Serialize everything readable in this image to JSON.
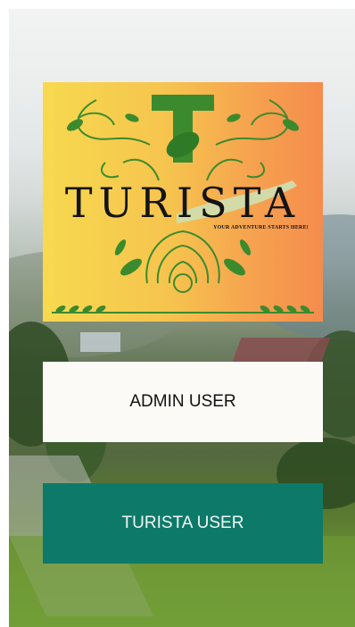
{
  "logo": {
    "letter": "T",
    "brand": "TURISTA",
    "tagline": "YOUR ADVENTURE STARTS HERE!"
  },
  "buttons": {
    "admin_label": "ADMIN USER",
    "turista_label": "TURISTA USER"
  },
  "colors": {
    "turista_button": "#0d7a69",
    "admin_button": "#fbfaf7",
    "logo_green": "#3b8b2e",
    "logo_gradient_start": "#f7d94f",
    "logo_gradient_end": "#f58c4d"
  }
}
